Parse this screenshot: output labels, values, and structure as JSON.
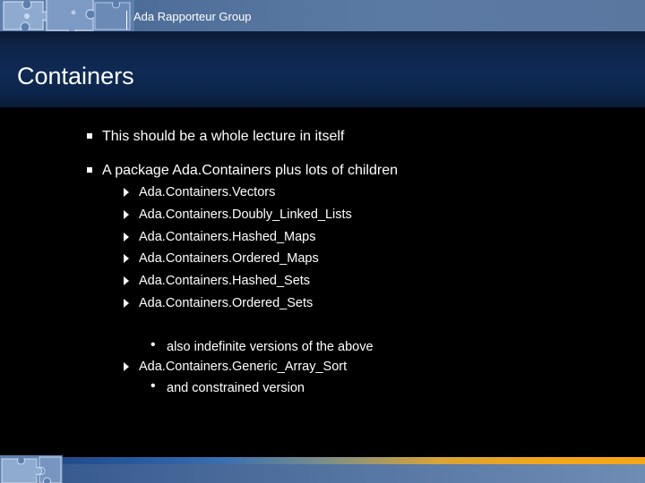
{
  "header": {
    "group_name": "Ada Rapporteur Group"
  },
  "slide": {
    "title": "Containers",
    "bullets": [
      {
        "text": "This should be a whole lecture in itself"
      },
      {
        "text": "A package Ada.Containers plus lots of children",
        "children": [
          {
            "text": "Ada.Containers.Vectors"
          },
          {
            "text": "Ada.Containers.Doubly_Linked_Lists"
          },
          {
            "text": "Ada.Containers.Hashed_Maps"
          },
          {
            "text": "Ada.Containers.Ordered_Maps"
          },
          {
            "text": "Ada.Containers.Hashed_Sets"
          },
          {
            "text": "Ada.Containers.Ordered_Sets"
          },
          {
            "text": "also indefinite versions of the above"
          },
          {
            "text": "Ada.Containers.Generic_Array_Sort"
          },
          {
            "text": "and constrained version"
          }
        ]
      }
    ]
  },
  "colors": {
    "background": "#000000",
    "banner": "#4f6f9a",
    "title_band": "#0f2a55",
    "accent_orange": "#f2a619"
  },
  "icons": {
    "top_decoration": "puzzle-pieces-icon",
    "bottom_decoration": "puzzle-pieces-icon",
    "level1_bullet": "square-bullet-icon",
    "level2_bullet": "triangle-arrow-icon",
    "level3_bullet": "dot-bullet-icon"
  }
}
